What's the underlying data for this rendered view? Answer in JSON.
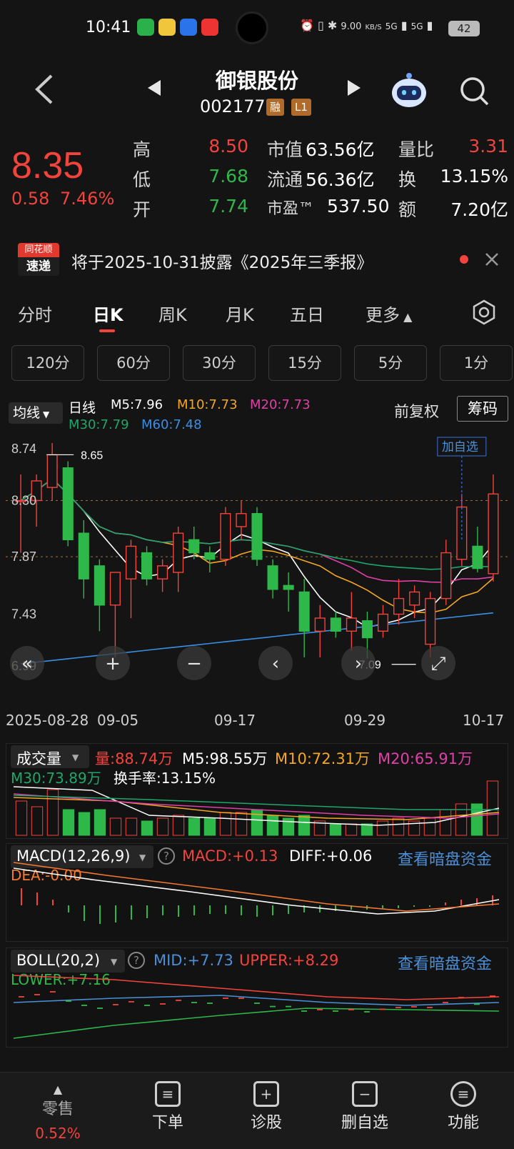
{
  "status_bar": {
    "time": "10:41",
    "net_speed": "9.00",
    "net_unit": "KB/S",
    "signal1": "5G",
    "signal2": "5G",
    "battery": "42"
  },
  "header": {
    "stock_name": "御银股份",
    "stock_code": "002177",
    "tag_margin": "融",
    "tag_level": "L1"
  },
  "quote": {
    "price": "8.35",
    "change": "0.58",
    "change_pct": "7.46%",
    "high_label": "高",
    "high": "8.50",
    "low_label": "低",
    "low": "7.68",
    "open_label": "开",
    "open": "7.74",
    "mktcap_label": "市值",
    "mktcap": "63.56亿",
    "float_label": "流通",
    "float_cap": "56.36亿",
    "pe_label": "市盈™",
    "pe": "537.50",
    "volratio_label": "量比",
    "volratio": "3.31",
    "turnover_label": "换",
    "turnover": "13.15%",
    "amount_label": "额",
    "amount": "7.20亿"
  },
  "news": {
    "logo_top": "同花顺",
    "logo_bottom": "速递",
    "text": "将于2025-10-31披露《2025年三季报》"
  },
  "tabs": [
    "分时",
    "日K",
    "周K",
    "月K",
    "五日",
    "更多"
  ],
  "periods": [
    "120分",
    "60分",
    "30分",
    "15分",
    "5分",
    "1分"
  ],
  "legend": {
    "ma_select": "均线",
    "line_type": "日线",
    "m5": "M5:7.96",
    "m10": "M10:7.73",
    "m20": "M20:7.73",
    "m30": "M30:7.79",
    "m60": "M60:7.48",
    "fuquan": "前复权",
    "chouma": "筹码"
  },
  "colors": {
    "m5": "#ffffff",
    "m10": "#f5a623",
    "m20": "#e040a8",
    "m30": "#1fa66a",
    "m60": "#3a8ee6",
    "up": "#f2433c",
    "down": "#2fb84a"
  },
  "main_chart": {
    "y_labels": [
      "8.74",
      "8.30",
      "7.87",
      "7.43",
      "6.99"
    ],
    "high_mark": "8.65",
    "low_mark": "7.09",
    "add_watch": "加自选",
    "dates": [
      "2025-08-28",
      "09-05",
      "09-17",
      "09-29",
      "10-17"
    ]
  },
  "chart_data": {
    "type": "candlestick",
    "candles": [
      {
        "o": 8.3,
        "h": 8.5,
        "l": 7.9,
        "c": 8.3
      },
      {
        "o": 8.3,
        "h": 8.5,
        "l": 8.1,
        "c": 8.45
      },
      {
        "o": 8.4,
        "h": 8.74,
        "l": 8.3,
        "c": 8.65
      },
      {
        "o": 8.55,
        "h": 8.6,
        "l": 7.95,
        "c": 8.0
      },
      {
        "o": 8.05,
        "h": 8.15,
        "l": 7.55,
        "c": 7.7
      },
      {
        "o": 7.8,
        "h": 7.85,
        "l": 7.3,
        "c": 7.5
      },
      {
        "o": 7.5,
        "h": 7.7,
        "l": 7.1,
        "c": 7.75
      },
      {
        "o": 7.7,
        "h": 8.0,
        "l": 7.4,
        "c": 7.95
      },
      {
        "o": 7.9,
        "h": 7.95,
        "l": 7.65,
        "c": 7.7
      },
      {
        "o": 7.7,
        "h": 7.85,
        "l": 7.6,
        "c": 7.8
      },
      {
        "o": 7.75,
        "h": 8.1,
        "l": 7.6,
        "c": 8.05
      },
      {
        "o": 8.0,
        "h": 8.1,
        "l": 7.85,
        "c": 7.9
      },
      {
        "o": 7.9,
        "h": 7.95,
        "l": 7.75,
        "c": 7.85
      },
      {
        "o": 7.85,
        "h": 8.25,
        "l": 7.8,
        "c": 8.2
      },
      {
        "o": 8.1,
        "h": 8.3,
        "l": 8.0,
        "c": 8.2
      },
      {
        "o": 8.2,
        "h": 8.25,
        "l": 7.8,
        "c": 7.85
      },
      {
        "o": 7.8,
        "h": 7.85,
        "l": 7.55,
        "c": 7.62
      },
      {
        "o": 7.65,
        "h": 7.75,
        "l": 7.45,
        "c": 7.62
      },
      {
        "o": 7.6,
        "h": 7.7,
        "l": 7.1,
        "c": 7.3
      },
      {
        "o": 7.3,
        "h": 7.5,
        "l": 7.1,
        "c": 7.4
      },
      {
        "o": 7.4,
        "h": 7.45,
        "l": 7.25,
        "c": 7.3
      },
      {
        "o": 7.3,
        "h": 7.6,
        "l": 7.15,
        "c": 7.4
      },
      {
        "o": 7.38,
        "h": 7.45,
        "l": 7.09,
        "c": 7.25
      },
      {
        "o": 7.3,
        "h": 7.5,
        "l": 7.25,
        "c": 7.43
      },
      {
        "o": 7.43,
        "h": 7.7,
        "l": 7.35,
        "c": 7.55
      },
      {
        "o": 7.5,
        "h": 7.65,
        "l": 7.4,
        "c": 7.6
      },
      {
        "o": 7.2,
        "h": 7.6,
        "l": 7.1,
        "c": 7.55
      },
      {
        "o": 7.55,
        "h": 8.0,
        "l": 7.5,
        "c": 7.9
      },
      {
        "o": 7.85,
        "h": 8.35,
        "l": 7.8,
        "c": 8.25
      },
      {
        "o": 7.95,
        "h": 8.1,
        "l": 7.75,
        "c": 7.78
      },
      {
        "o": 7.74,
        "h": 8.5,
        "l": 7.68,
        "c": 8.35
      }
    ],
    "ylim": [
      6.99,
      8.74
    ]
  },
  "volume": {
    "title": "成交量",
    "vol": "量:88.74万",
    "m5": "M5:98.55万",
    "m10": "M10:72.31万",
    "m20": "M20:65.91万",
    "m30": "M30:73.89万",
    "turnover": "换手率:13.15%",
    "values": [
      0.6,
      0.5,
      0.8,
      0.45,
      0.4,
      0.45,
      0.3,
      0.3,
      0.25,
      0.3,
      0.35,
      0.3,
      0.3,
      0.4,
      0.4,
      0.45,
      0.35,
      0.3,
      0.35,
      0.25,
      0.2,
      0.2,
      0.2,
      0.25,
      0.3,
      0.25,
      0.3,
      0.45,
      0.55,
      0.55,
      0.95
    ]
  },
  "macd": {
    "title": "MACD(12,26,9)",
    "macd": "MACD:+0.13",
    "diff": "DIFF:+0.06",
    "dea": "DEA:-0.00",
    "link": "查看暗盘资金"
  },
  "boll": {
    "title": "BOLL(20,2)",
    "mid": "MID:+7.73",
    "upper": "UPPER:+8.29",
    "lower": "LOWER:+7.16",
    "link": "查看暗盘资金"
  },
  "bottom_nav": {
    "items": [
      "零售",
      "下单",
      "诊股",
      "删自选",
      "功能"
    ],
    "retail_pct": "0.52%"
  }
}
